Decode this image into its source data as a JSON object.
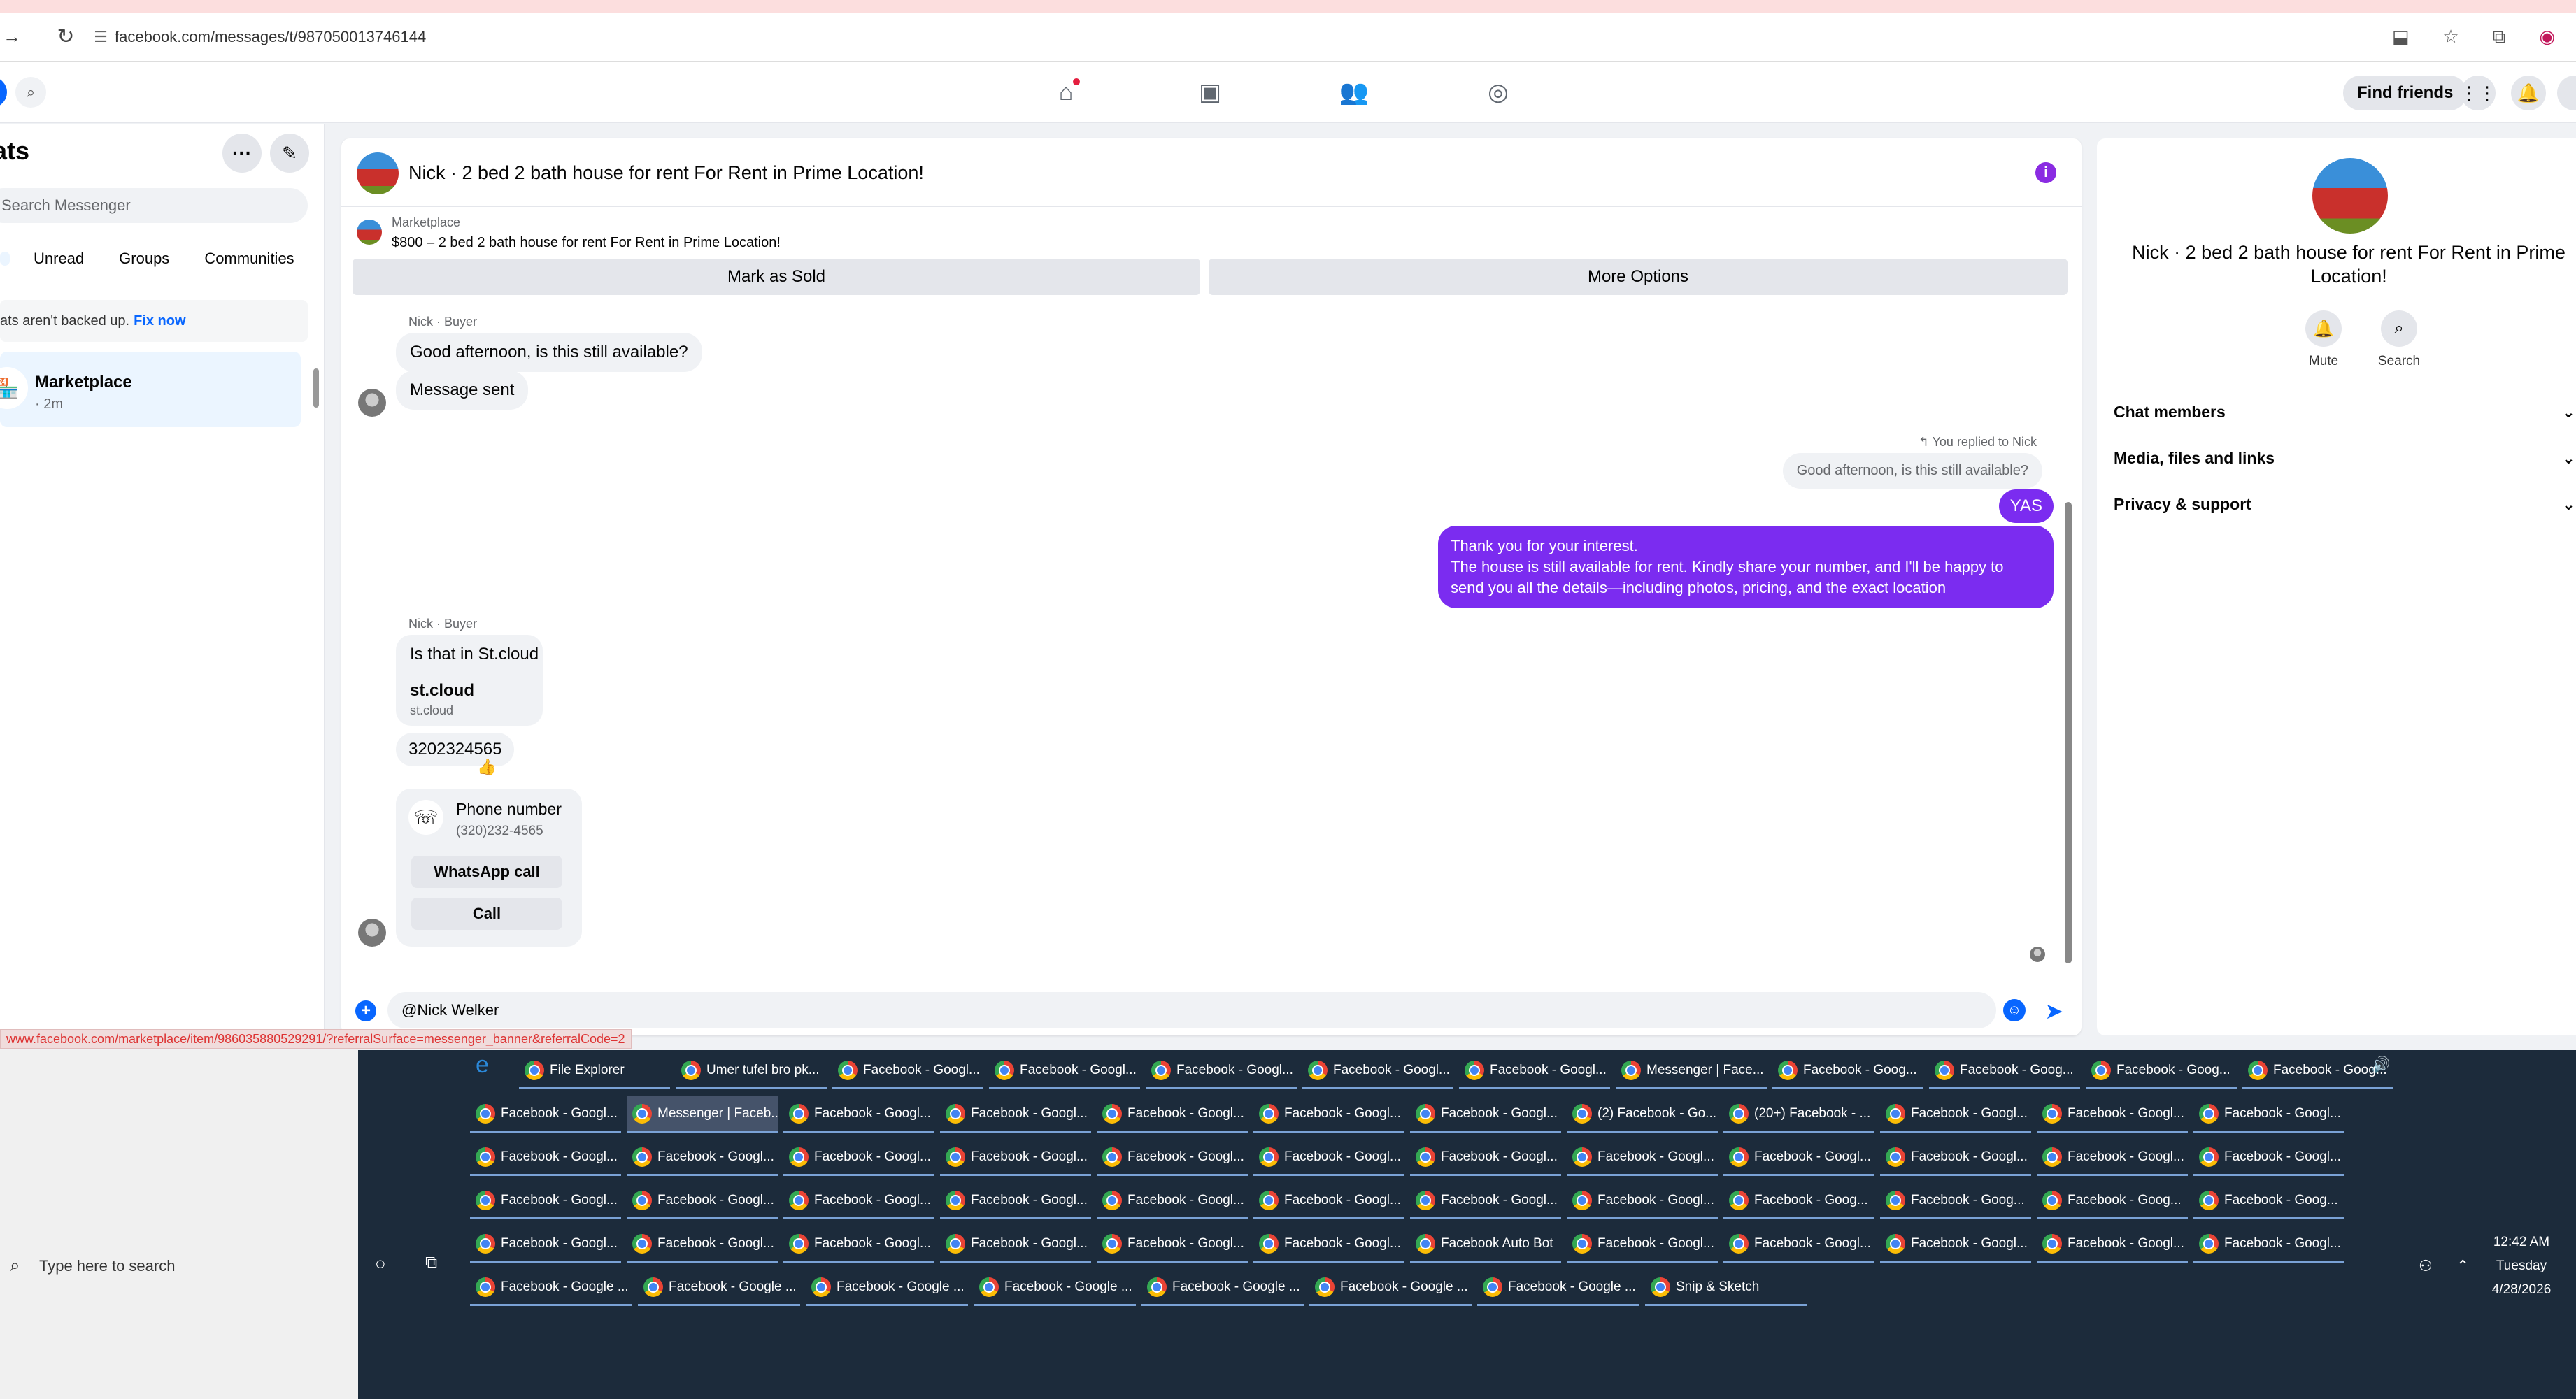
{
  "browser": {
    "url": "facebook.com/messages/t/987050013746144",
    "status_url": "www.facebook.com/marketplace/item/986035880529291/?referralSurface=messenger_banner&referralCode=2"
  },
  "fbbar": {
    "find_friends": "Find friends"
  },
  "left": {
    "title": "ats",
    "search_placeholder": "Search Messenger",
    "filters": [
      "Unread",
      "Groups",
      "Communities"
    ],
    "backup_text": "ats aren't backed up.",
    "backup_link": "Fix now",
    "convo": {
      "name": "Marketplace",
      "time": "· 2m"
    }
  },
  "chat": {
    "title": "Nick · 2 bed 2 bath house for rent For Rent in Prime Location!",
    "marketplace_label": "Marketplace",
    "listing": "$800 – 2 bed 2 bath house for rent For Rent in Prime Location!",
    "mark_sold": "Mark as Sold",
    "more_options": "More Options",
    "sender1": "Nick · Buyer",
    "msg1": "Good afternoon, is this still available?",
    "msg2": "Message sent",
    "replied_label": "You replied to Nick",
    "quoted": "Good afternoon, is this still available?",
    "my_reply": "YAS",
    "my_long_1": "Thank you for your interest.",
    "my_long_2": "The house is still available for rent. Kindly share your number, and I'll be happy to",
    "my_long_3": "send you all the details—including photos, pricing, and the exact location",
    "sender2": "Nick · Buyer",
    "msg3": "Is that in St.cloud",
    "link_title": "st.cloud",
    "link_sub": "st.cloud",
    "msg4": "3202324565",
    "reaction": "👍",
    "phone_title": "Phone number",
    "phone_sub": "(320)232-4565",
    "whatsapp_call": "WhatsApp call",
    "call": "Call",
    "composer_value": "@Nick Welker"
  },
  "right": {
    "name": "Nick · 2 bed 2 bath house for rent For Rent in Prime Location!",
    "mute": "Mute",
    "search": "Search",
    "sections": [
      "Chat members",
      "Media, files and links",
      "Privacy & support"
    ]
  },
  "taskbar": {
    "search_text": "Type here to search",
    "time": "12:42 AM",
    "day": "Tuesday",
    "date": "4/28/2026",
    "row1": [
      "File Explorer",
      "Umer tufel bro pk...",
      "Facebook - Googl...",
      "Facebook - Googl...",
      "Facebook - Googl...",
      "Facebook - Googl...",
      "Facebook - Googl...",
      "Messenger | Face...",
      "Facebook - Goog...",
      "Facebook - Goog...",
      "Facebook - Goog...",
      "Facebook - Goog..."
    ],
    "row2": [
      "Facebook - Googl...",
      "Messenger | Faceb...",
      "Facebook - Googl...",
      "Facebook - Googl...",
      "Facebook - Googl...",
      "Facebook - Googl...",
      "Facebook - Googl...",
      "(2) Facebook - Go...",
      "(20+) Facebook - ...",
      "Facebook - Googl...",
      "Facebook - Googl...",
      "Facebook - Googl..."
    ],
    "row3": [
      "Facebook - Googl...",
      "Facebook - Googl...",
      "Facebook - Googl...",
      "Facebook - Googl...",
      "Facebook - Googl...",
      "Facebook - Googl...",
      "Facebook - Googl...",
      "Facebook - Googl...",
      "Facebook - Googl...",
      "Facebook - Googl...",
      "Facebook - Googl...",
      "Facebook - Googl..."
    ],
    "row4": [
      "Facebook - Googl...",
      "Facebook - Googl...",
      "Facebook - Googl...",
      "Facebook - Googl...",
      "Facebook - Googl...",
      "Facebook - Googl...",
      "Facebook - Googl...",
      "Facebook - Googl...",
      "Facebook - Goog...",
      "Facebook - Goog...",
      "Facebook - Goog...",
      "Facebook - Goog..."
    ],
    "row5": [
      "Facebook - Googl...",
      "Facebook - Googl...",
      "Facebook - Googl...",
      "Facebook - Googl...",
      "Facebook - Googl...",
      "Facebook - Googl...",
      "Facebook Auto Bot",
      "Facebook - Googl...",
      "Facebook - Googl...",
      "Facebook - Googl...",
      "Facebook - Googl...",
      "Facebook - Googl..."
    ],
    "row6": [
      "Facebook - Google ...",
      "Facebook - Google ...",
      "Facebook - Google ...",
      "Facebook - Google ...",
      "Facebook - Google ...",
      "Facebook - Google ...",
      "Facebook - Google ...",
      "Snip & Sketch"
    ]
  }
}
